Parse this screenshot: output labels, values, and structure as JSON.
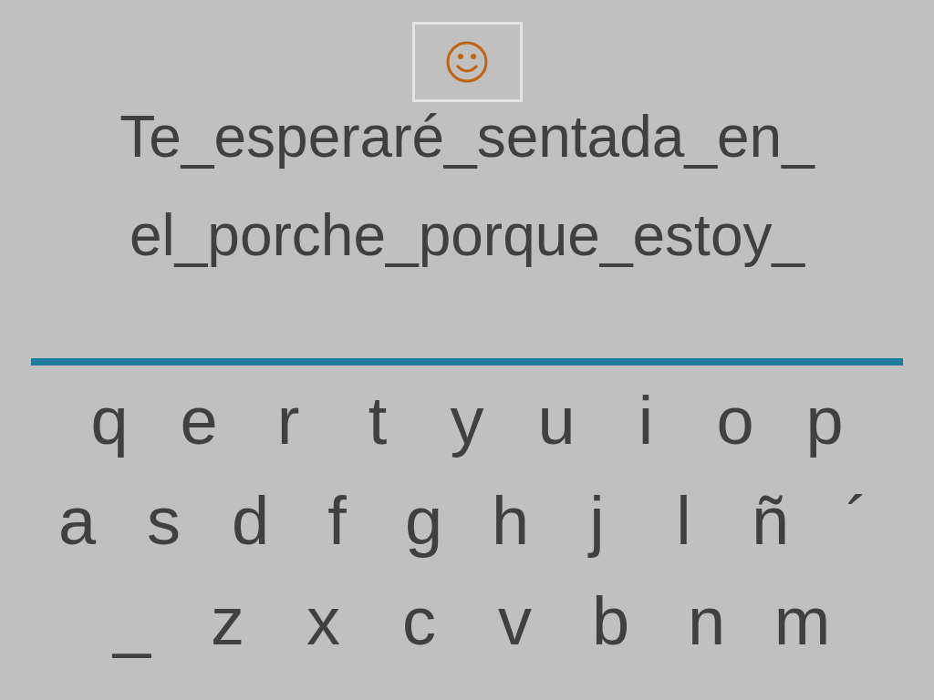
{
  "text_lines": [
    "Te_esperaré_sentada_en_",
    "el_porche_porque_estoy_"
  ],
  "keyboard": {
    "rows": [
      [
        "q",
        "e",
        "r",
        "t",
        "y",
        "u",
        "i",
        "o",
        "p"
      ],
      [
        "a",
        "s",
        "d",
        "f",
        "g",
        "h",
        "j",
        "l",
        "ñ",
        "´"
      ],
      [
        "_",
        "z",
        "x",
        "c",
        "v",
        "b",
        "n",
        "m"
      ]
    ]
  }
}
